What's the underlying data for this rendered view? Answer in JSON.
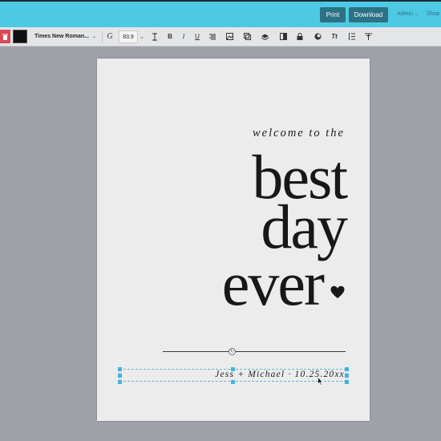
{
  "topbar": {
    "print_label": "Print",
    "download_label": "Download",
    "admin_label": "Admin",
    "shop_label": "Shop"
  },
  "toolbar": {
    "font_name": "Times New Roman...",
    "font_size": "83.9",
    "color_swatch": "#111111",
    "icons": [
      "trash-icon",
      "font-style-icon",
      "line-height-icon",
      "bold-icon",
      "italic-icon",
      "underline-icon",
      "align-icon",
      "image-icon",
      "duplicate-icon",
      "layers-icon",
      "bring-forward-icon",
      "lock-icon",
      "effects-icon",
      "text-transform-icon",
      "spacing-icon",
      "align-top-icon"
    ]
  },
  "design": {
    "welcome": "welcome to the",
    "line1": "best",
    "line2": "day",
    "line3": "ever",
    "signature": "Jess + Michael · 10.25.20xx"
  },
  "colors": {
    "topbar": "#4ec9e4",
    "button": "#2c7285",
    "selection": "#3eb5e0",
    "trash": "#d54c56"
  }
}
